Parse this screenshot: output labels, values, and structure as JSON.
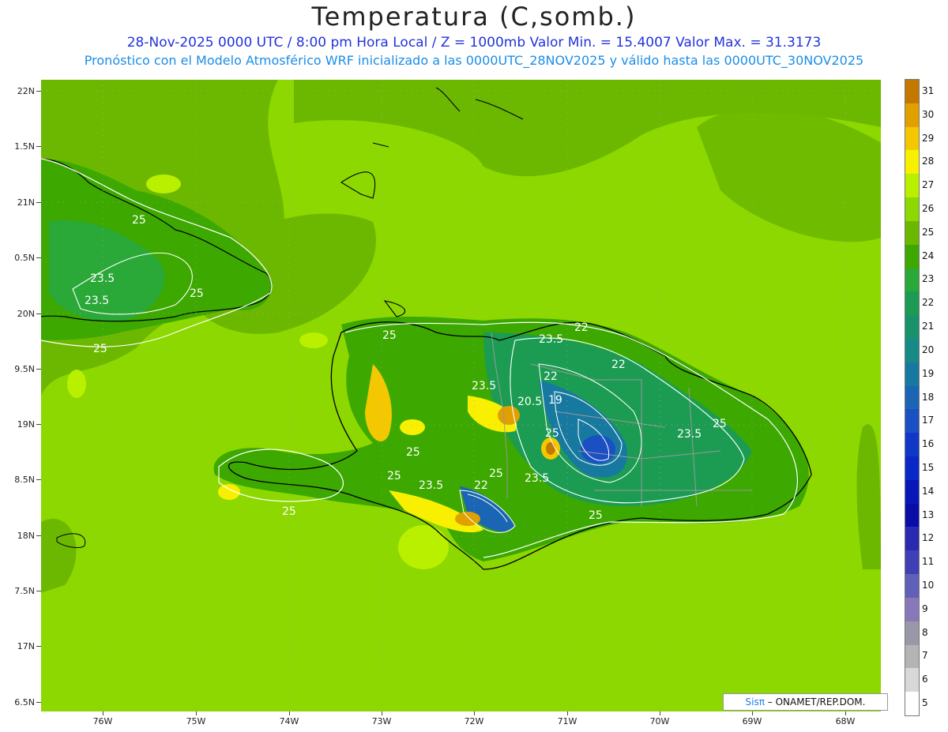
{
  "title": "Temperatura (C,somb.)",
  "subtitle_line1": "28-Nov-2025  0000 UTC / 8:00 pm Hora Local / Z = 1000mb   Valor Min. = 15.4007  Valor Max. = 31.3173",
  "subtitle_line2": "Pronóstico con el Modelo Atmosférico WRF inicializado a las 0000UTC_28NOV2025 y válido hasta las  0000UTC_30NOV2025",
  "lat_labels": [
    "22N",
    "1.5N",
    "21N",
    "0.5N",
    "20N",
    "9.5N",
    "19N",
    "8.5N",
    "18N",
    "7.5N",
    "17N",
    "6.5N"
  ],
  "lon_labels": [
    "76W",
    "75W",
    "74W",
    "73W",
    "72W",
    "71W",
    "70W",
    "69W",
    "68W"
  ],
  "colorbar": {
    "levels": [
      "31",
      "30",
      "29",
      "28",
      "27",
      "26",
      "25",
      "24",
      "23",
      "22",
      "21",
      "20",
      "19",
      "18",
      "17",
      "16",
      "15",
      "14",
      "13",
      "12",
      "11",
      "10",
      "9",
      "8",
      "7",
      "6",
      "5"
    ],
    "colors": [
      "#c57800",
      "#e0a000",
      "#f4c800",
      "#f8f000",
      "#b8f000",
      "#8cd800",
      "#6cb800",
      "#3ca800",
      "#2aa838",
      "#1c9c52",
      "#19926c",
      "#178a88",
      "#1879a0",
      "#1a66b4",
      "#1a50c4",
      "#1038c8",
      "#0a28c8",
      "#0818b8",
      "#0a0ca8",
      "#2a2ab0",
      "#4040b4",
      "#6060b8",
      "#8878b8",
      "#9898a8",
      "#b4b4b4",
      "#d8d8d8",
      "#ffffff"
    ]
  },
  "map": {
    "sea_color": "#8cd800",
    "land_colors": {
      "warm": "#6cb800",
      "mid": "#3ca800",
      "cool": "#2aa838",
      "cold": "#1879a0",
      "coldest": "#1a50c4",
      "hot": "#f8f000",
      "hotter": "#e0a000"
    },
    "contour_labels": [
      "25",
      "23.5",
      "23.5",
      "25",
      "25",
      "25",
      "23.5",
      "22",
      "22",
      "23.5",
      "20.5",
      "19",
      "25",
      "23.5",
      "25",
      "25",
      "25",
      "23.5",
      "22",
      "22",
      "25",
      "23.5",
      "25",
      "25"
    ]
  },
  "credit": {
    "brand": "Sisπ",
    "text": "– ONAMET/REP.DOM."
  }
}
